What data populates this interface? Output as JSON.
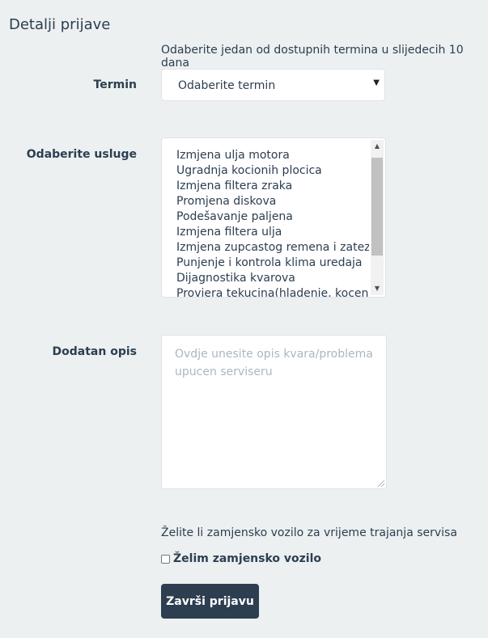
{
  "page": {
    "section_title": "Detalji prijave",
    "term_hint": "Odaberite jedan od dostupnih termina u slijedecih 10 dana"
  },
  "termin": {
    "label": "Termin",
    "selected": "Odaberite termin",
    "arrow_icon": "triangle-down"
  },
  "usluge": {
    "label": "Odaberite usluge",
    "items": [
      "Izmjena ulja motora",
      "Ugradnja kocionih plocica",
      "Izmjena filtera zraka",
      "Promjena diskova",
      "Podešavanje paljena",
      "Izmjena filtera ulja",
      "Izmjena zupcastog remena i zatezaca",
      "Punjenje i kontrola klima uredaja",
      "Dijagnostika kvarova",
      "Provjera tekucina(hladenje, kocenje)"
    ]
  },
  "opis": {
    "label": "Dodatan opis",
    "placeholder": "Ovdje unesite opis kvara/problema upucen serviseru",
    "value": ""
  },
  "vozilo": {
    "question": "Želite li zamjensko vozilo za vrijeme trajanja servisa",
    "checkbox_label": "Želim zamjensko vozilo",
    "checked": false
  },
  "submit": {
    "label": "Završi prijavu"
  },
  "colors": {
    "background": "#ecf0f1",
    "text": "#2c3e50",
    "button": "#2c3e50",
    "placeholder": "#acb6c0"
  }
}
